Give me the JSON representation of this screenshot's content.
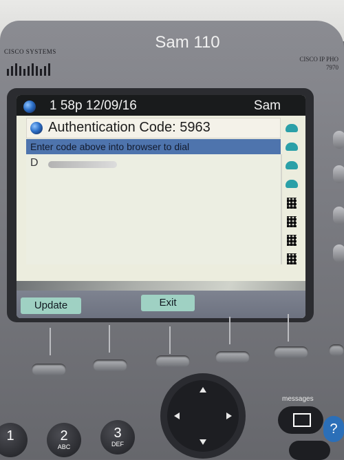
{
  "phone": {
    "brand": "CISCO SYSTEMS",
    "model_line1": "CISCO IP PHO",
    "model_line2": "7970",
    "line_label": "Sam 110"
  },
  "screen": {
    "header": {
      "time": "1 58p 12/09/16",
      "user": "Sam"
    },
    "title": "Authentication Code: 5963",
    "instruction": "Enter code above into browser to dial",
    "dialed_prefix": "D"
  },
  "softkeys": {
    "update": "Update",
    "exit": "Exit"
  },
  "keypad": [
    {
      "num": "1",
      "letters": ""
    },
    {
      "num": "2",
      "letters": "ABC"
    },
    {
      "num": "3",
      "letters": "DEF"
    }
  ],
  "messages_label": "messages",
  "help_label": "?",
  "colors": {
    "softkey": "#9fd1c3",
    "selection": "#4e74ad",
    "screen": "#ecedde"
  }
}
